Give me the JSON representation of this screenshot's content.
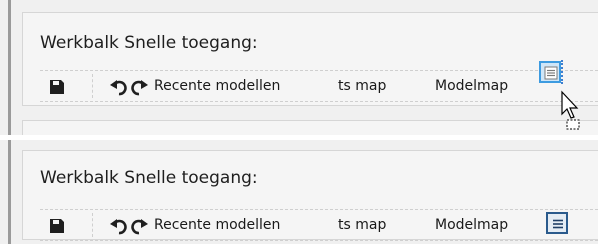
{
  "quick_access_label": "Werkbalk Snelle toegang:",
  "toolbar": {
    "recent_models": "Recente modellen",
    "ts_map": "ts map",
    "model_map": "Modelmap"
  },
  "colors": {
    "hover_border": "#3d9be0",
    "active_border": "#2a5a8c"
  },
  "icons": [
    "save-icon",
    "undo-icon",
    "redo-icon",
    "menu-lines-icon",
    "mouse-cursor-icon",
    "drag-move-icon"
  ]
}
